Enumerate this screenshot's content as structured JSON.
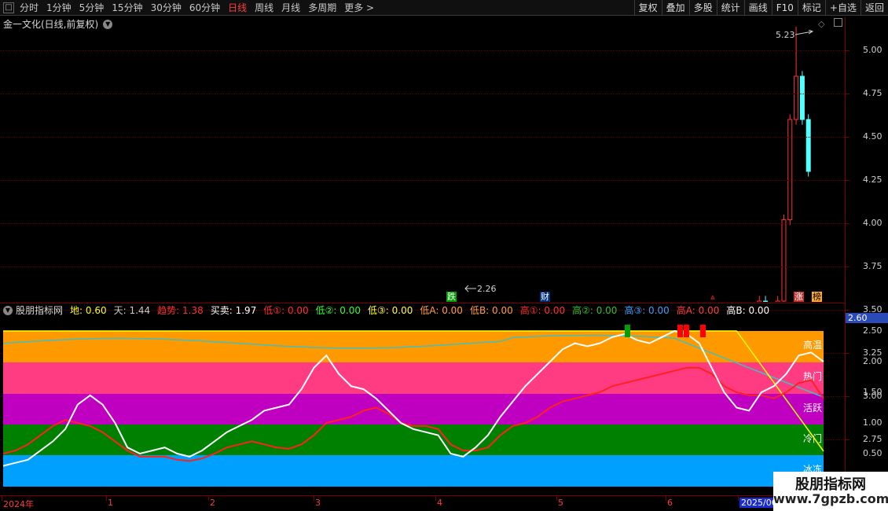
{
  "toolbar": {
    "periods": [
      "分时",
      "1分钟",
      "5分钟",
      "15分钟",
      "30分钟",
      "60分钟",
      "日线",
      "周线",
      "月线",
      "多周期",
      "更多 >"
    ],
    "active_period": "日线",
    "tools": [
      "复权",
      "叠加",
      "多股",
      "统计",
      "画线",
      "F10",
      "标记",
      "+自选",
      "返回"
    ]
  },
  "main": {
    "title": "金一文化(日线,前复权)",
    "price_axis": [
      "5.00",
      "4.75",
      "4.50",
      "4.25",
      "4.00",
      "3.75",
      "3.50",
      "3.25",
      "3.00",
      "2.75",
      "2.50"
    ],
    "high_annotation": "5.23",
    "low_annotation": "2.26",
    "markers": {
      "die": "跌",
      "cai": "财",
      "zhang": "涨",
      "bang": "榜"
    }
  },
  "indicator": {
    "name": "股朋指标网",
    "values": [
      {
        "label": "地:",
        "value": "0.60",
        "color": "#ffff00"
      },
      {
        "label": "天:",
        "value": "1.44",
        "color": "#c8c8c8"
      },
      {
        "label": "趋势:",
        "value": "1.38",
        "color": "#ff3030"
      },
      {
        "label": "买卖:",
        "value": "1.97",
        "color": "#ffffff"
      },
      {
        "label": "低①:",
        "value": "0.00",
        "color": "#ff3030"
      },
      {
        "label": "低②:",
        "value": "0.00",
        "color": "#30ff30"
      },
      {
        "label": "低③:",
        "value": "0.00",
        "color": "#ffff40"
      },
      {
        "label": "低A:",
        "value": "0.00",
        "color": "#ffa040"
      },
      {
        "label": "低B:",
        "value": "0.00",
        "color": "#ffa040"
      },
      {
        "label": "高①:",
        "value": "0.00",
        "color": "#ff3030"
      },
      {
        "label": "高②:",
        "value": "0.00",
        "color": "#30c030"
      },
      {
        "label": "高③:",
        "value": "0.00",
        "color": "#40a0ff"
      },
      {
        "label": "高A:",
        "value": "0.00",
        "color": "#ff4040"
      },
      {
        "label": "高B:",
        "value": "0.00",
        "color": "#ffffff"
      }
    ],
    "current_value": "2.60",
    "axis": [
      "2.50",
      "2.00",
      "1.50",
      "1.00",
      "0.50"
    ],
    "zones": [
      "高温",
      "热门",
      "活跃",
      "冷门",
      "冰冻"
    ]
  },
  "dates": [
    "2024年",
    "1",
    "2",
    "3",
    "4",
    "5",
    "6",
    "2025/06"
  ],
  "watermark": {
    "title": "股朋指标网",
    "url": "www.7gpzb.com"
  },
  "colors": {
    "up": "#ff3232",
    "down": "#54ffff",
    "band_hot": "#ff9900",
    "band_pink": "#ff3c82",
    "band_purple": "#c000c0",
    "band_green": "#008000",
    "band_blue": "#00a0ff"
  }
}
